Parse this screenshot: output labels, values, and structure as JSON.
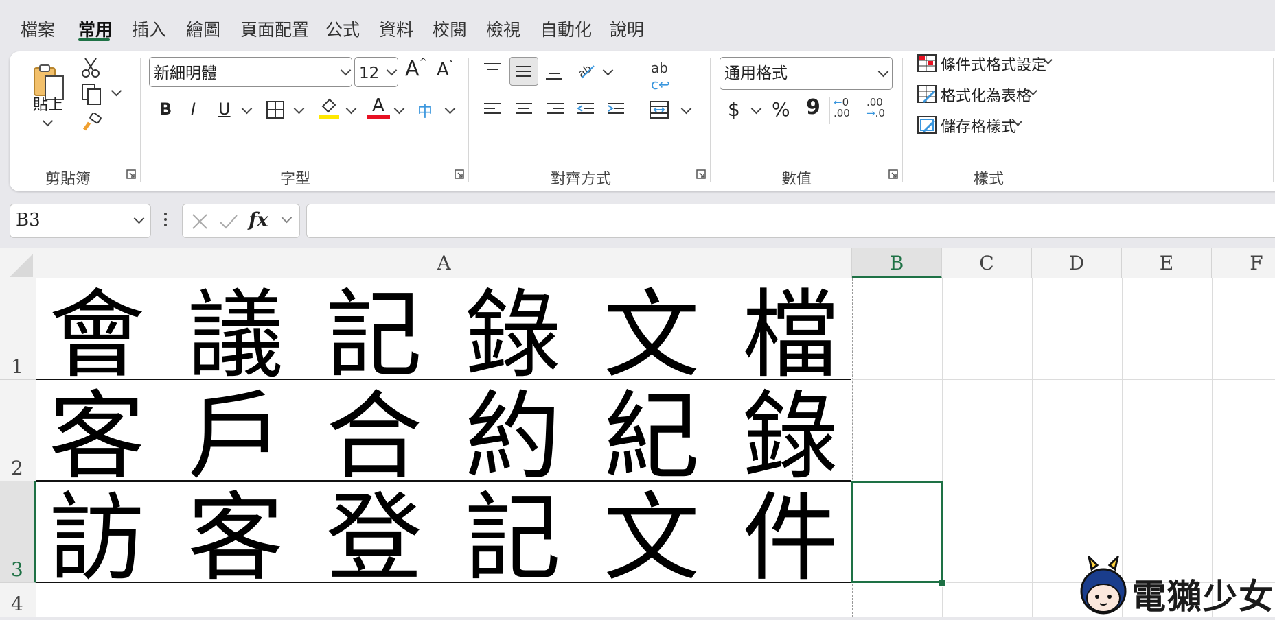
{
  "menu": {
    "tabs": [
      "檔案",
      "常用",
      "插入",
      "繪圖",
      "頁面配置",
      "公式",
      "資料",
      "校閱",
      "檢視",
      "自動化",
      "說明"
    ],
    "active_index": 1
  },
  "ribbon": {
    "clipboard": {
      "paste_label": "貼上",
      "group_label": "剪貼簿"
    },
    "font": {
      "font_name": "新細明體",
      "font_size": "12",
      "group_label": "字型",
      "bold": "B",
      "italic": "I",
      "underline": "U",
      "font_color_letter": "A",
      "phonetic_glyph": "中"
    },
    "alignment": {
      "group_label": "對齊方式",
      "wrap_glyph": "ab"
    },
    "number": {
      "format": "通用格式",
      "currency": "$",
      "percent": "%",
      "comma": "9",
      "group_label": "數值",
      "inc_decimal": ".00",
      "dec_decimal": ".00"
    },
    "styles": {
      "conditional": "條件式格式設定",
      "as_table": "格式化為表格",
      "cell_styles": "儲存格樣式",
      "group_label": "樣式"
    }
  },
  "formula_bar": {
    "name_box": "B3",
    "fx": "fx",
    "formula": ""
  },
  "sheet": {
    "columns": [
      "A",
      "B",
      "C",
      "D",
      "E",
      "F"
    ],
    "rows": [
      "1",
      "2",
      "3",
      "4"
    ],
    "cells_A": [
      [
        "會",
        "議",
        "記",
        "錄",
        "文",
        "檔"
      ],
      [
        "客",
        "戶",
        "合",
        "約",
        "紀",
        "錄"
      ],
      [
        "訪",
        "客",
        "登",
        "記",
        "文",
        "件"
      ]
    ],
    "selected": "B3"
  },
  "watermark": {
    "text": "電獺少女"
  },
  "colors": {
    "accent": "#1e7145",
    "fill_bar": "#ffe800",
    "font_bar": "#e81123"
  }
}
